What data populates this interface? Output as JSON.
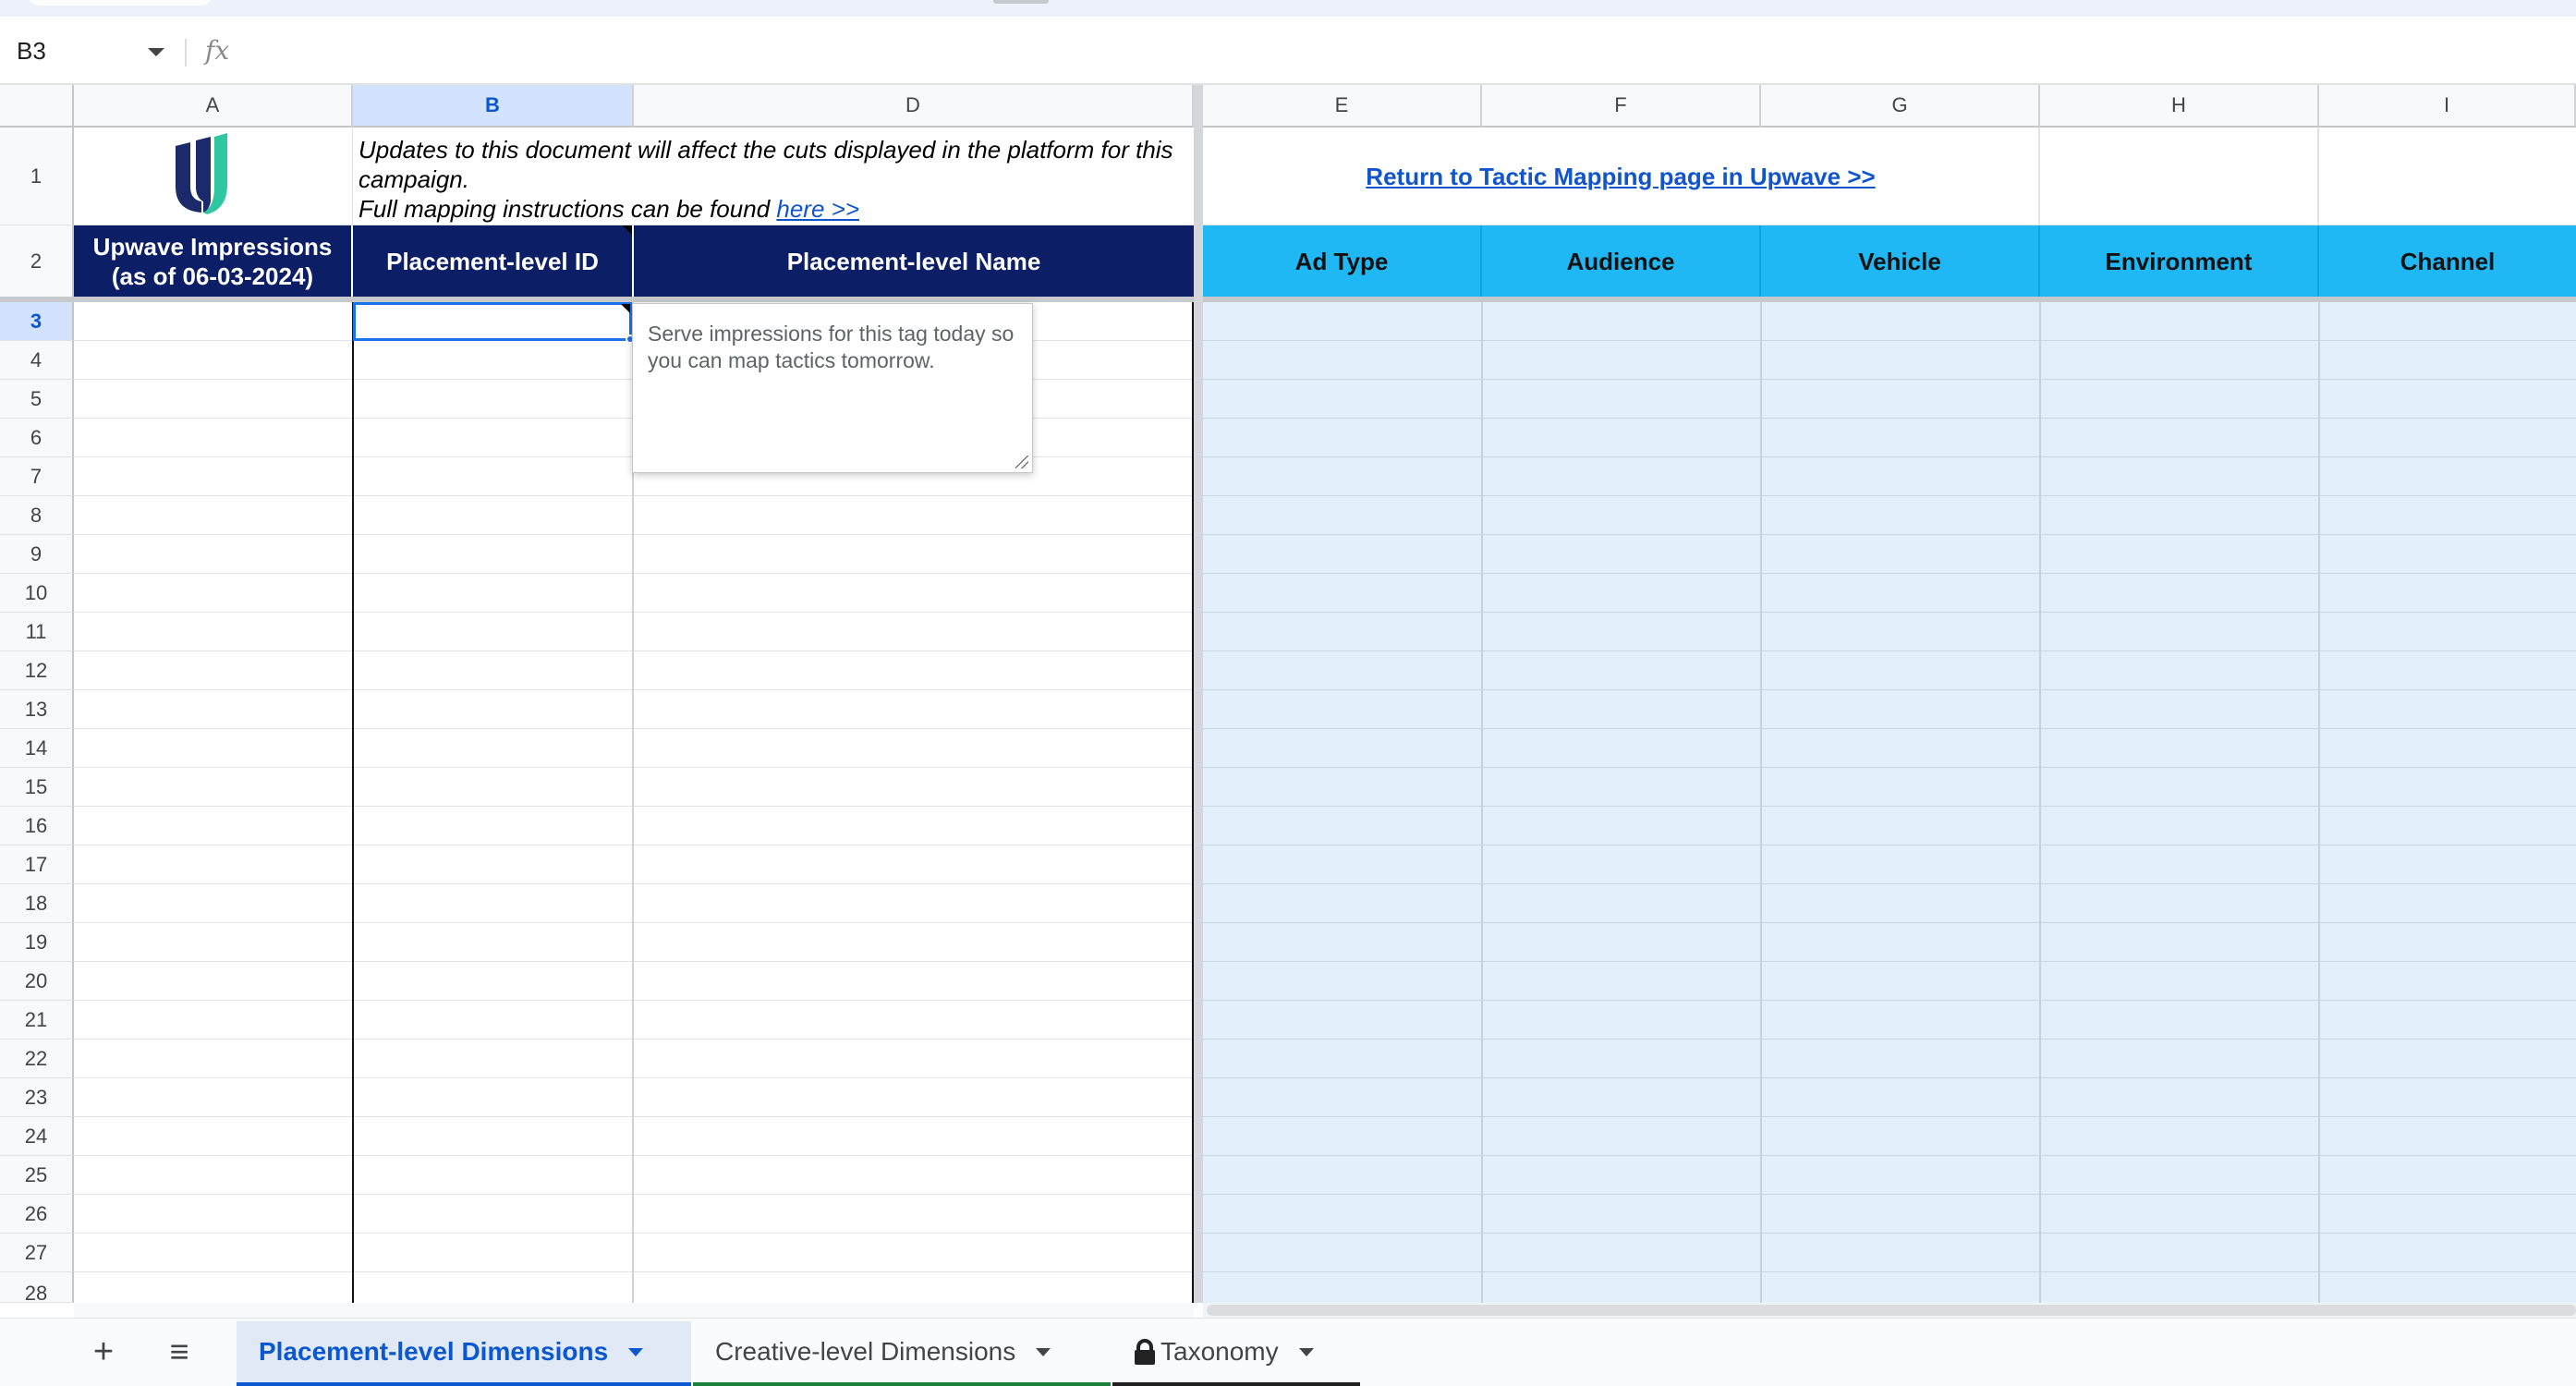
{
  "app": {
    "name_box": "B3",
    "formula_icon": "fx"
  },
  "columns": [
    "A",
    "B",
    "D",
    "E",
    "F",
    "G",
    "H",
    "I"
  ],
  "selected_column": "B",
  "rows": [
    "1",
    "2",
    "3",
    "4",
    "5",
    "6",
    "7",
    "8",
    "9",
    "10",
    "11",
    "12",
    "13",
    "14",
    "15",
    "16",
    "17",
    "18",
    "19",
    "20",
    "21",
    "22",
    "23",
    "24",
    "25",
    "26",
    "27",
    "28"
  ],
  "selected_row": "3",
  "row1": {
    "note_line1": "Updates to this document will affect the cuts displayed in the platform for this campaign.",
    "note_line2": "Full mapping instructions can be found ",
    "note_link": "here >>",
    "return_link": "Return to Tactic Mapping page in Upwave >>"
  },
  "headers": {
    "impressions": "Upwave Impressions (as of 06-03-2024)",
    "placement_id": "Placement-level ID",
    "placement_name": "Placement-level Name",
    "ad_type": "Ad Type",
    "audience": "Audience",
    "vehicle": "Vehicle",
    "environment": "Environment",
    "channel": "Channel"
  },
  "comment": {
    "text": "Serve impressions for this tag today so you can map tactics tomorrow."
  },
  "tabs": {
    "add_label": "+",
    "menu_label": "≡",
    "items": [
      {
        "label": "Placement-level Dimensions",
        "active": true
      },
      {
        "label": "Creative-level Dimensions",
        "active": false
      },
      {
        "label": "Taxonomy",
        "active": false,
        "locked": true
      }
    ]
  },
  "colors": {
    "header_dark": "#0b1e66",
    "header_blue": "#1fb8f5",
    "right_fill": "#e3f0fb",
    "selection": "#1a73e8",
    "logo_navy": "#1b2a6b",
    "logo_teal": "#2fc7a0"
  }
}
